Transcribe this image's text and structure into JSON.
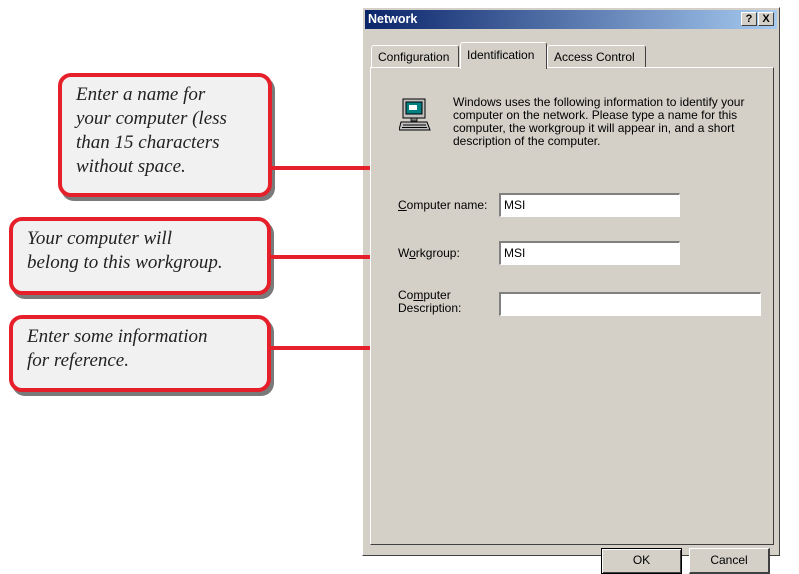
{
  "callouts": {
    "name_hint": [
      "Enter a name for",
      "your computer (less",
      "than 15 characters",
      "without space."
    ],
    "workgroup_hint": [
      "Your computer will",
      "belong to this workgroup."
    ],
    "description_hint": [
      "Enter some information",
      "for reference."
    ]
  },
  "dialog": {
    "title": "Network",
    "help_glyph": "?",
    "close_glyph": "X",
    "tabs": [
      "Configuration",
      "Identification",
      "Access Control"
    ],
    "info_text": "Windows uses the following information to identify your computer on the network.  Please type a name for this computer, the workgroup it will appear in, and a short description of the computer.",
    "fields": {
      "computer_name": {
        "label_mnemonic": "C",
        "label_rest": "omputer name:",
        "value": "MSI"
      },
      "workgroup": {
        "label_pre": "W",
        "label_mnemonic": "o",
        "label_rest": "rkgroup:",
        "value": "MSI"
      },
      "description": {
        "label_line1_pre": "Co",
        "label_line1_mnemonic": "m",
        "label_line1_rest": "puter",
        "label_line2": "Description:",
        "value": ""
      }
    },
    "buttons": {
      "ok": "OK",
      "cancel": "Cancel"
    }
  }
}
